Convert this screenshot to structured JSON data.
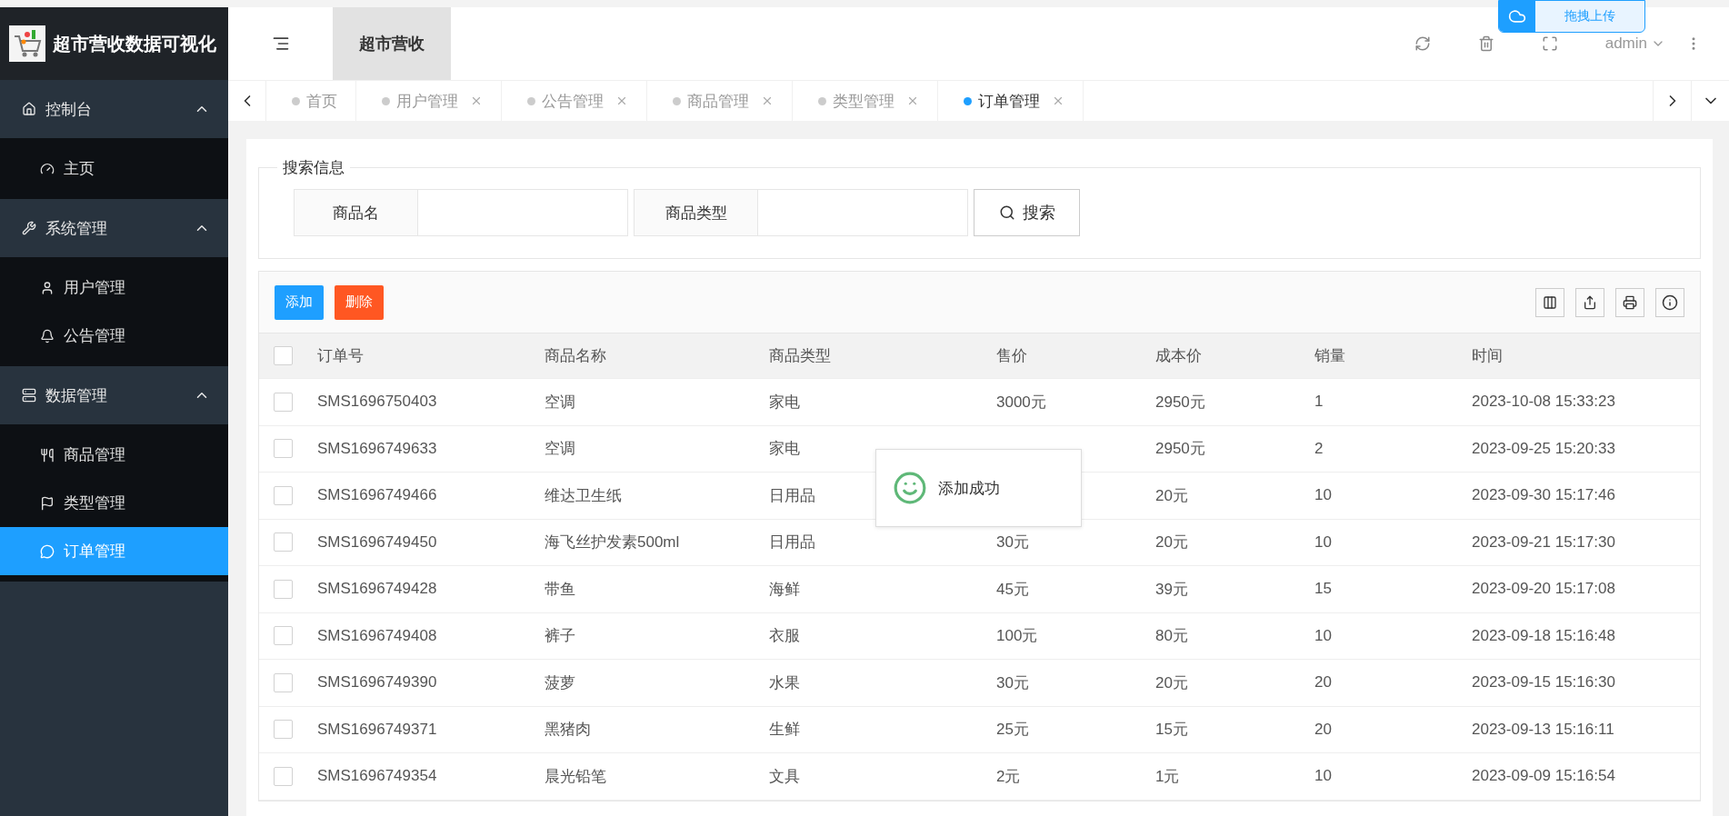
{
  "brand": {
    "title": "超市营收数据可视化"
  },
  "header": {
    "title": "超市营收",
    "user": "admin"
  },
  "upload_widget": {
    "label": "拖拽上传"
  },
  "sidebar": {
    "groups": [
      {
        "label": "控制台",
        "expanded": true,
        "items": [
          {
            "label": "主页",
            "selected": false
          }
        ]
      },
      {
        "label": "系统管理",
        "expanded": true,
        "items": [
          {
            "label": "用户管理",
            "selected": false
          },
          {
            "label": "公告管理",
            "selected": false
          }
        ]
      },
      {
        "label": "数据管理",
        "expanded": true,
        "items": [
          {
            "label": "商品管理",
            "selected": false
          },
          {
            "label": "类型管理",
            "selected": false
          },
          {
            "label": "订单管理",
            "selected": true
          }
        ]
      }
    ]
  },
  "tabs": [
    {
      "label": "首页",
      "selected": false,
      "closable": false
    },
    {
      "label": "用户管理",
      "selected": false,
      "closable": true
    },
    {
      "label": "公告管理",
      "selected": false,
      "closable": true
    },
    {
      "label": "商品管理",
      "selected": false,
      "closable": true
    },
    {
      "label": "类型管理",
      "selected": false,
      "closable": true
    },
    {
      "label": "订单管理",
      "selected": true,
      "closable": true
    }
  ],
  "search": {
    "legend": "搜索信息",
    "fields": [
      {
        "label": "商品名"
      },
      {
        "label": "商品类型"
      }
    ],
    "button": "搜索"
  },
  "toolbar": {
    "buttons": [
      {
        "label": "添加",
        "kind": "primary"
      },
      {
        "label": "删除",
        "kind": "danger"
      }
    ]
  },
  "table": {
    "all_checked": false,
    "columns": [
      "订单号",
      "商品名称",
      "商品类型",
      "售价",
      "成本价",
      "销量",
      "时间"
    ],
    "rows": [
      {
        "checked": false,
        "cells": [
          "SMS1696750403",
          "空调",
          "家电",
          "3000元",
          "2950元",
          "1",
          "2023-10-08 15:33:23"
        ]
      },
      {
        "checked": false,
        "cells": [
          "SMS1696749633",
          "空调",
          "家电",
          null,
          "2950元",
          "2",
          "2023-09-25 15:20:33"
        ]
      },
      {
        "checked": false,
        "cells": [
          "SMS1696749466",
          "维达卫生纸",
          "日用品",
          null,
          "20元",
          "10",
          "2023-09-30 15:17:46"
        ]
      },
      {
        "checked": false,
        "cells": [
          "SMS1696749450",
          "海飞丝护发素500ml",
          "日用品",
          "30元",
          "20元",
          "10",
          "2023-09-21 15:17:30"
        ]
      },
      {
        "checked": false,
        "cells": [
          "SMS1696749428",
          "带鱼",
          "海鲜",
          "45元",
          "39元",
          "15",
          "2023-09-20 15:17:08"
        ]
      },
      {
        "checked": false,
        "cells": [
          "SMS1696749408",
          "裤子",
          "衣服",
          "100元",
          "80元",
          "10",
          "2023-09-18 15:16:48"
        ]
      },
      {
        "checked": false,
        "cells": [
          "SMS1696749390",
          "菠萝",
          "水果",
          "30元",
          "20元",
          "20",
          "2023-09-15 15:16:30"
        ]
      },
      {
        "checked": false,
        "cells": [
          "SMS1696749371",
          "黑猪肉",
          "生鲜",
          "25元",
          "15元",
          "20",
          "2023-09-13 15:16:11"
        ]
      },
      {
        "checked": false,
        "cells": [
          "SMS1696749354",
          "晨光铅笔",
          "文具",
          "2元",
          "1元",
          "10",
          "2023-09-09 15:16:54"
        ]
      }
    ]
  },
  "toast": {
    "message": "添加成功"
  }
}
